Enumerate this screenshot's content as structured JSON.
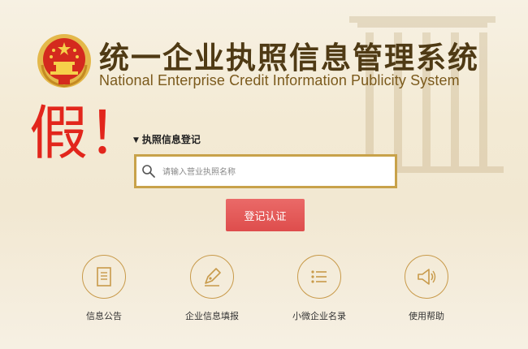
{
  "header": {
    "title_cn": "统一企业执照信息管理系统",
    "title_en": "National Enterprise Credit Information Publicity System"
  },
  "stamp": {
    "text": "假！"
  },
  "search": {
    "section_label": "执照信息登记",
    "placeholder": "请输入营业执照名称"
  },
  "submit": {
    "label": "登记认证"
  },
  "quick_links": [
    {
      "label": "信息公告",
      "icon": "document-icon"
    },
    {
      "label": "企业信息填报",
      "icon": "pen-icon"
    },
    {
      "label": "小微企业名录",
      "icon": "list-icon"
    },
    {
      "label": "使用帮助",
      "icon": "megaphone-icon"
    }
  ],
  "colors": {
    "accent_gold": "#c8a24a",
    "title_brown": "#4f3a14",
    "stamp_red": "#e2261c",
    "button_red": "#de4d4c"
  }
}
